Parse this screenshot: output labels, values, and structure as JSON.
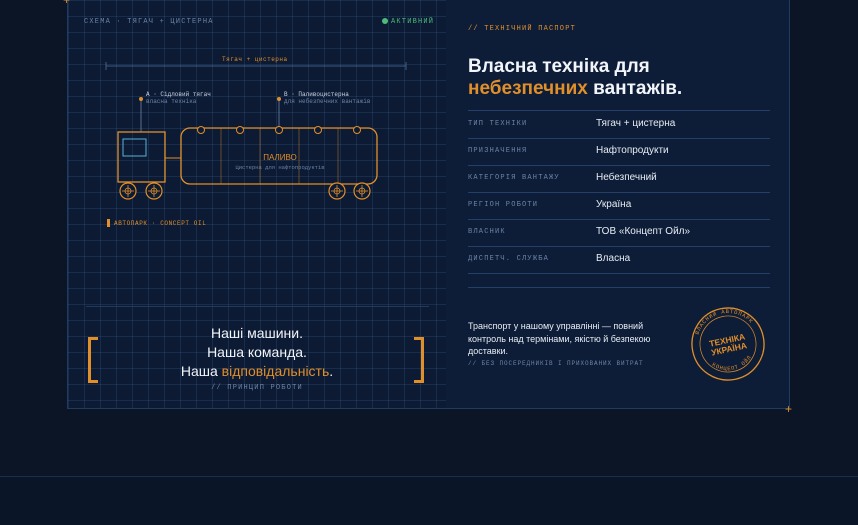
{
  "schema": {
    "header": "СХЕМА · ТЯГАЧ + ЦИСТЕРНА",
    "status": "АКТИВНИЙ",
    "span_label": "Тягач + цистерна",
    "marker_a_title": "А · Сідловий тягач",
    "marker_a_sub": "власна техніка",
    "marker_b_title": "В · Паливоцистерна",
    "marker_b_sub": "для небезпечних вантажів",
    "tank_title": "ПАЛИВО",
    "tank_sub": "Цистерна для нафтопродуктів",
    "fleet_tag": "АВТОПАРК · CONCEPT OIL"
  },
  "motto": {
    "line1": "Наші машини.",
    "line2": "Наша команда.",
    "line3_prefix": "Наша ",
    "line3_accent": "відповідальність",
    "line3_suffix": ".",
    "caption": "// ПРИНЦИП РОБОТИ"
  },
  "passport": {
    "eyebrow": "// ТЕХНІЧНИЙ ПАСПОРТ",
    "title_line1": "Власна техніка для",
    "title_accent": "небезпечних",
    "title_rest": " вантажів.",
    "fields": [
      {
        "label": "ТИП ТЕХНІКИ",
        "value": "Тягач + цистерна"
      },
      {
        "label": "ПРИЗНАЧЕННЯ",
        "value": "Нафтопродукти"
      },
      {
        "label": "КАТЕГОРІЯ ВАНТАЖУ",
        "value": "Небезпечний"
      },
      {
        "label": "РЕГІОН РОБОТИ",
        "value": "Україна"
      },
      {
        "label": "ВЛАСНИК",
        "value": "ТОВ «Концепт Ойл»"
      },
      {
        "label": "ДИСПЕТЧ. СЛУЖБА",
        "value": "Власна"
      }
    ],
    "description": "Транспорт у нашому управлінні — повний контроль над термінами, якістю й безпекою доставки.",
    "note": "// БЕЗ ПОСЕРЕДНИКІВ І ПРИХОВАНИХ ВИТРАТ"
  },
  "stamp": {
    "top_arc": "ВЛАСНИЙ АВТОПАРК",
    "center_line1": "ТЕХНІКА",
    "center_line2": "УКРАЇНА",
    "bottom_arc": "КОНЦЕПТ ОЙЛ"
  },
  "colors": {
    "accent": "#e08f2b",
    "status_green": "#4cbb7a",
    "background": "#0b1526"
  },
  "icons": [
    "crosshair-icon",
    "status-dot-icon",
    "tanker-truck-icon",
    "stamp-seal-icon"
  ]
}
